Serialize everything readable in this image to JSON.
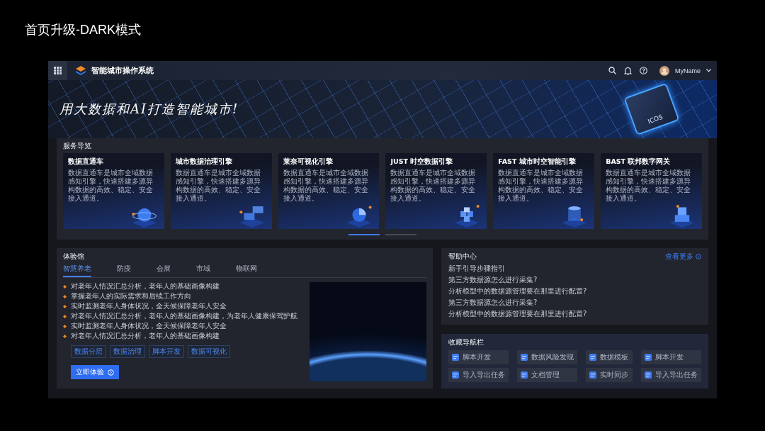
{
  "page_title": "首页升级-DARK模式",
  "header": {
    "app_title": "智能城市操作系统",
    "user_name": "MyName"
  },
  "banner": {
    "slogan": "用大数据和AI打造智能城市!",
    "chip_label": "ICOS"
  },
  "services": {
    "title": "服务导览",
    "cards": [
      {
        "title": "数据直通车",
        "description": "数据直通车是城市全域数据感知引擎，快速搭建多源异构数据的高效、稳定、安全接入通道。"
      },
      {
        "title": "城市数据治理引擎",
        "description": "数据直通车是城市全域数据感知引擎，快速搭建多源异构数据的高效、稳定、安全接入通道。"
      },
      {
        "title": "莱奈可视化引擎",
        "description": "数据直通车是城市全域数据感知引擎，快速搭建多源异构数据的高效、稳定、安全接入通道。"
      },
      {
        "title": "JUST 时空数据引擎",
        "description": "数据直通车是城市全域数据感知引擎，快速搭建多源异构数据的高效、稳定、安全接入通道。"
      },
      {
        "title": "FAST 城市时空智能引擎",
        "description": "数据直通车是城市全域数据感知引擎，快速搭建多源异构数据的高效、稳定、安全接入通道。"
      },
      {
        "title": "BAST 联邦数字网关",
        "description": "数据直通车是城市全域数据感知引擎，快速搭建多源异构数据的高效、稳定、安全接入通道。"
      }
    ],
    "pages": [
      {
        "selected": true
      },
      {
        "selected": false
      }
    ]
  },
  "experience": {
    "title": "体验馆",
    "tabs": [
      {
        "label": "智慧养老",
        "selected": true
      },
      {
        "label": "防疫",
        "selected": false
      },
      {
        "label": "会展",
        "selected": false
      },
      {
        "label": "市域",
        "selected": false
      },
      {
        "label": "物联网",
        "selected": false
      }
    ],
    "bullets": [
      "对老年人情况汇总分析，老年人的基础画像构建",
      "掌握老年人的实际需求和后续工作方向",
      "实时监测老年人身体状况，全天候保障老年人安全",
      "对老年人情况汇总分析，老年人的基础画像构建，为老年人健康保驾护航",
      "实时监测老年人身体状况，全天候保障老年人安全",
      "对老年人情况汇总分析，老年人的基础画像构建"
    ],
    "tags": [
      "数据分层",
      "数据治理",
      "脚本开发",
      "数据可视化"
    ],
    "button": "立即体验"
  },
  "help": {
    "title": "帮助中心",
    "more_link": "查看更多",
    "items": [
      "新手引导步骤指引",
      "第三方数据源怎么进行采集?",
      "分析模型中的数据源管理要在那里进行配置?",
      "第三方数据源怎么进行采集?",
      "分析模型中的数据源管理要在那里进行配置?"
    ]
  },
  "favorites": {
    "title": "收藏导航栏",
    "items": [
      "脚本开发",
      "数据风险发现",
      "数据模板",
      "脚本开发",
      "导入导出任务",
      "文档管理",
      "实时同步",
      "导入导出任务"
    ]
  }
}
